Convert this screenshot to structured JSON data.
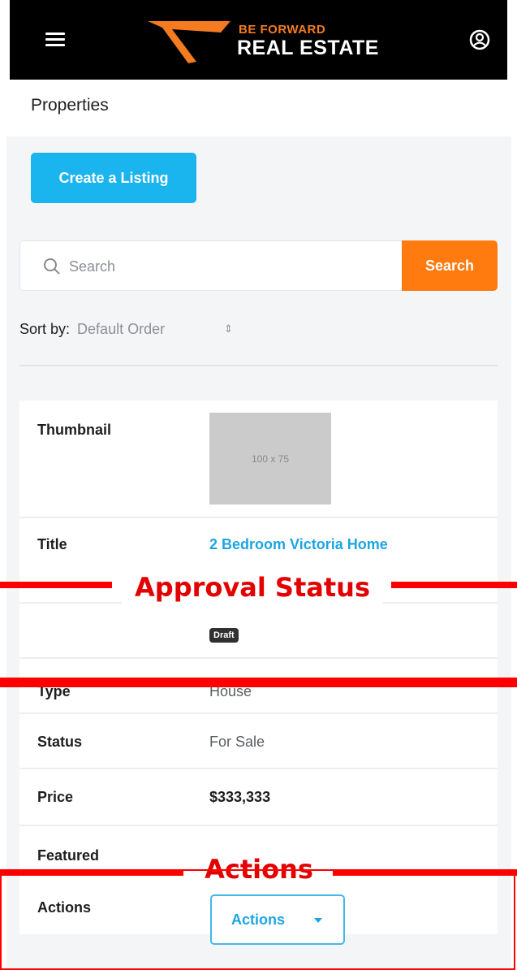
{
  "navbar": {
    "logo_top": "BE FORWARD",
    "logo_bottom": "REAL ESTATE",
    "colors": {
      "background": "#000000",
      "accent": "#f47b20"
    }
  },
  "page": {
    "title": "Properties",
    "create_button": "Create a Listing"
  },
  "search": {
    "placeholder": "Search",
    "button": "Search"
  },
  "sort": {
    "label": "Sort by:",
    "value": "Default Order"
  },
  "listing": {
    "thumbnail_label": "Thumbnail",
    "thumbnail_placeholder": "100 x 75",
    "title_label": "Title",
    "title_value": "2 Bedroom Victoria Home",
    "approval_badge": "Draft",
    "type_label": "Type",
    "type_value": "House",
    "status_label": "Status",
    "status_value": "For Sale",
    "price_label": "Price",
    "price_value": "$333,333",
    "featured_label": "Featured",
    "actions_label": "Actions",
    "actions_button": "Actions"
  },
  "annotations": {
    "approval_status": "Approval Status",
    "actions": "Actions",
    "color": "#ff0000"
  }
}
